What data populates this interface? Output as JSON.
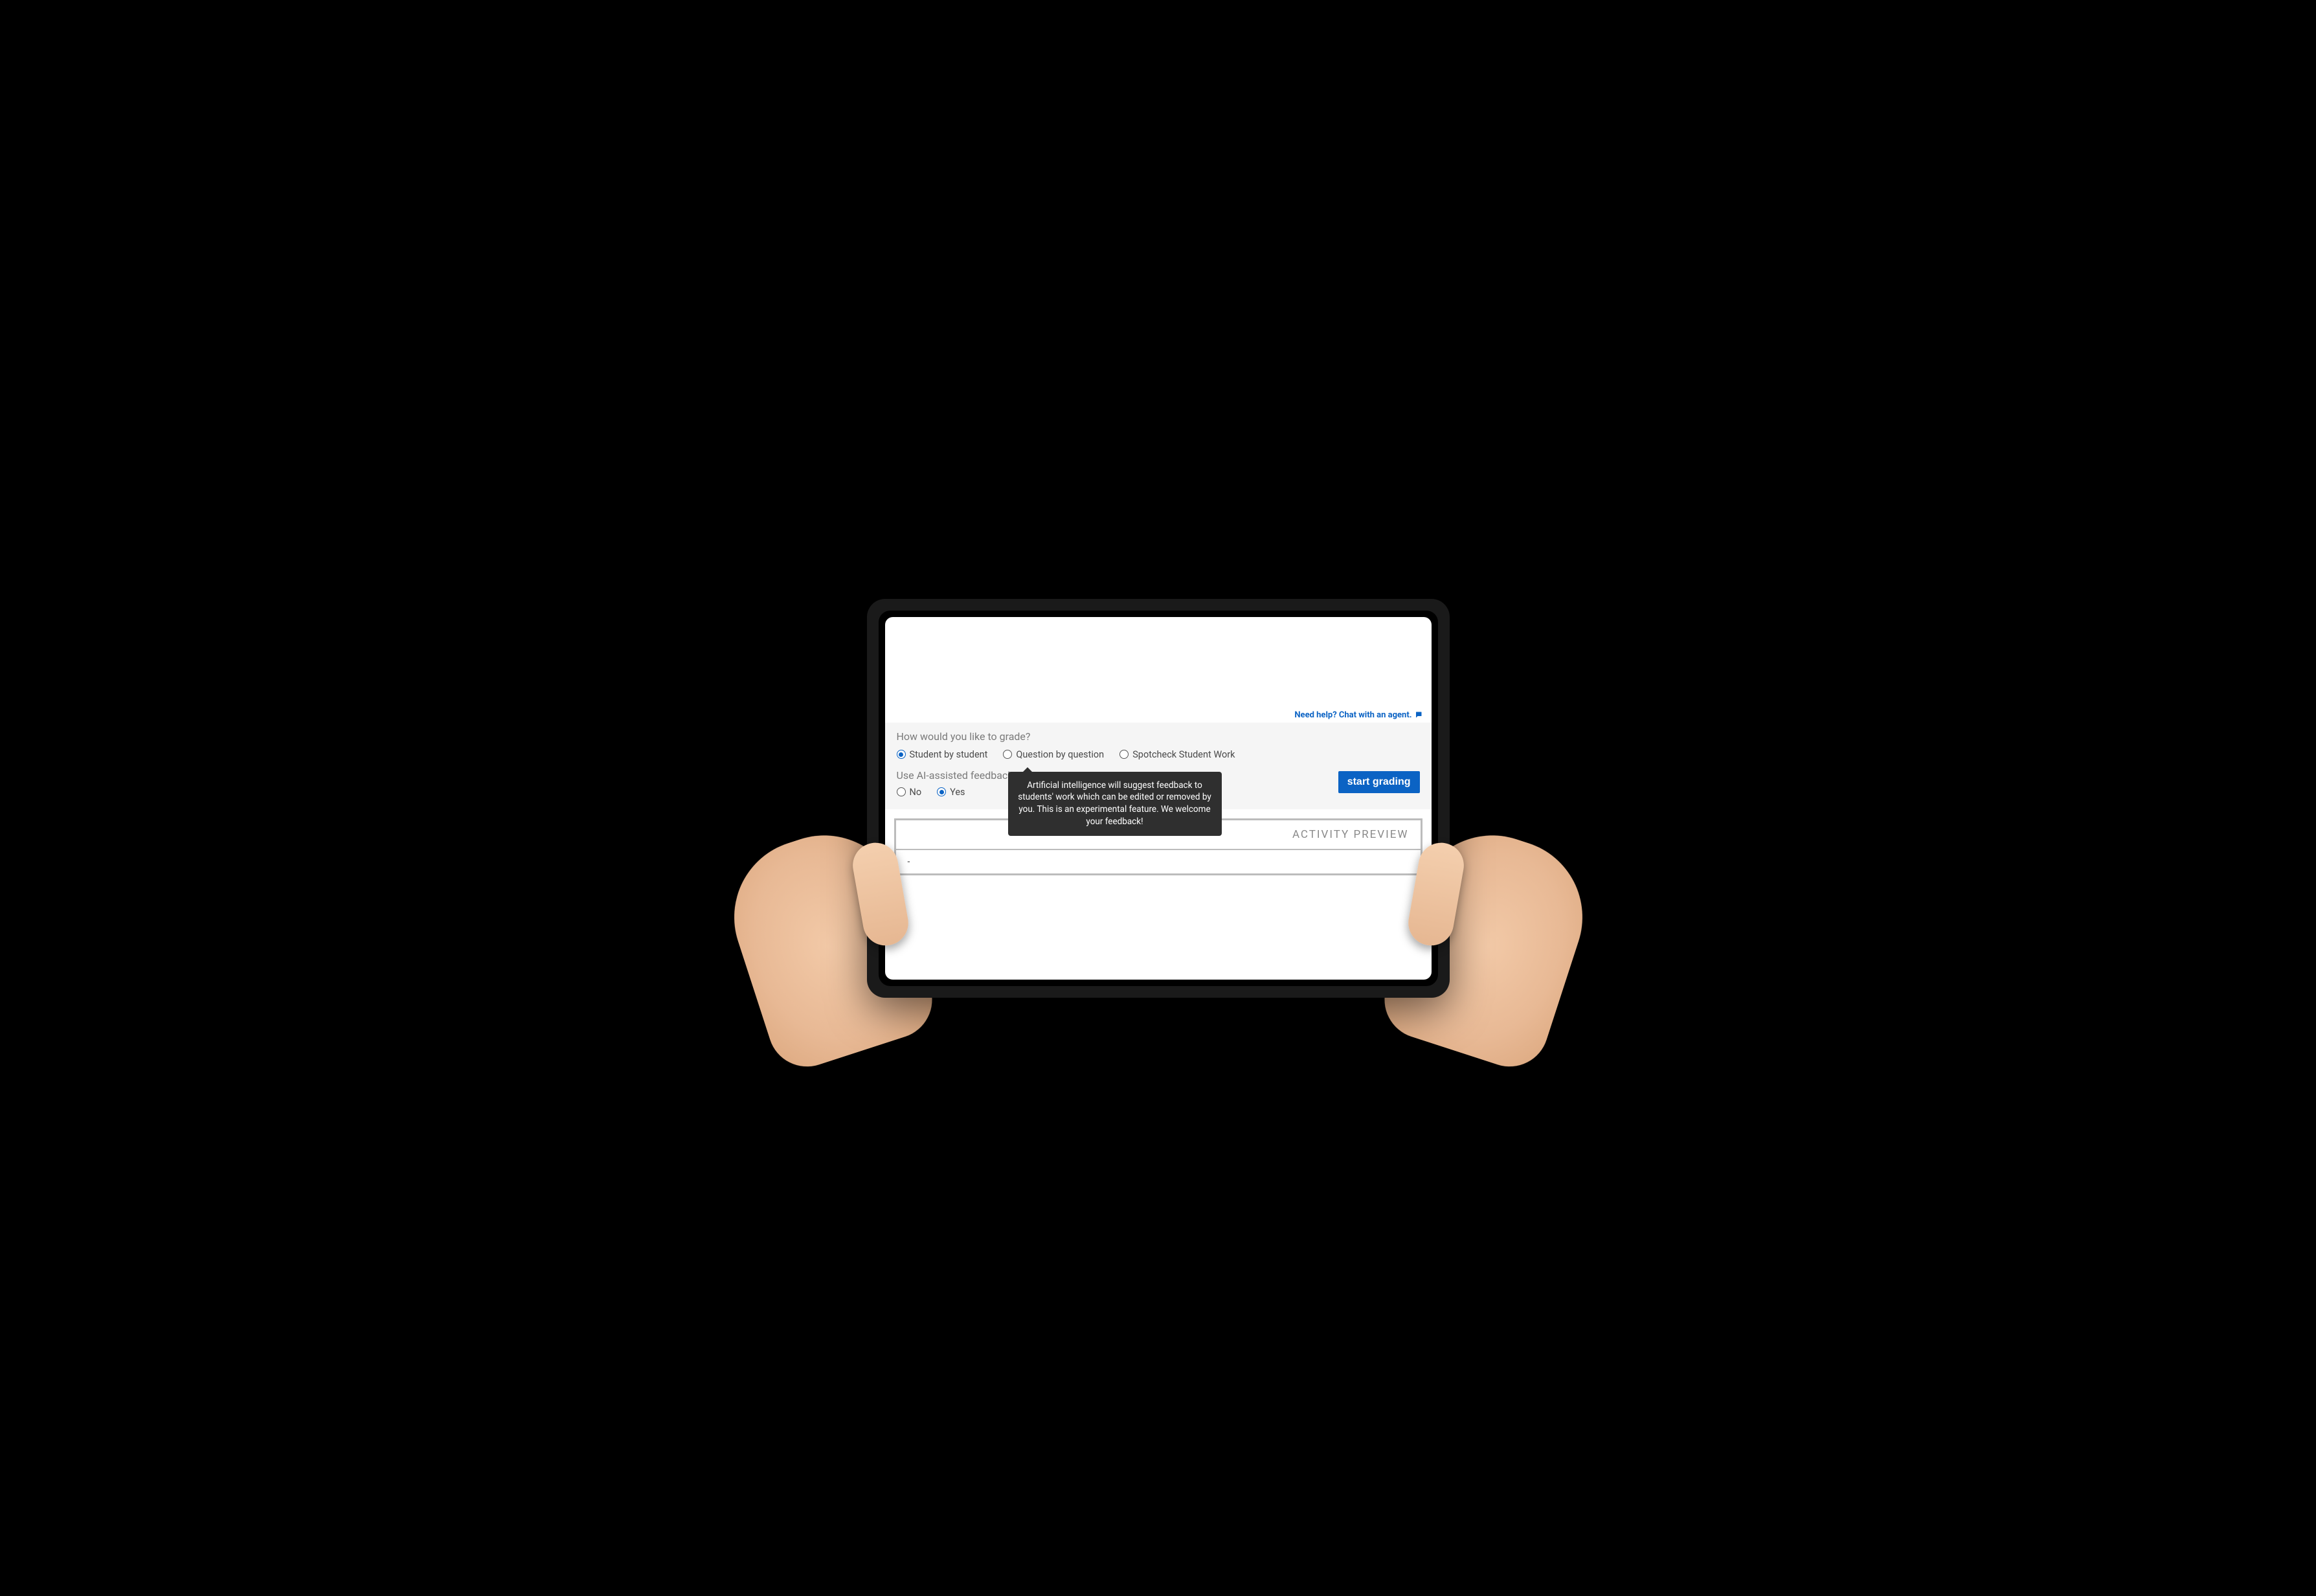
{
  "help": {
    "text": "Need help? Chat with an agent."
  },
  "grading": {
    "question": "How would you like to grade?",
    "options": [
      {
        "label": "Student by student",
        "selected": true
      },
      {
        "label": "Question by question",
        "selected": false
      },
      {
        "label": "Spotcheck Student Work",
        "selected": false
      }
    ]
  },
  "aiFeedback": {
    "question": "Use AI-assisted feedback?",
    "options": [
      {
        "label": "No",
        "selected": false
      },
      {
        "label": "Yes",
        "selected": true
      }
    ],
    "tooltip": "Artificial intelligence will suggest feedback to students' work which can be edited or removed by you. This is an experimental feature. We welcome your feedback!"
  },
  "actions": {
    "startGrading": "start grading"
  },
  "preview": {
    "title": "ACTIVITY PREVIEW",
    "body": "-"
  },
  "colors": {
    "accent": "#0b63c4",
    "panelBg": "#f5f5f5",
    "tooltipBg": "#2f2f2f",
    "mutedText": "#7a7a7a",
    "borderGray": "#bcbcbc"
  }
}
